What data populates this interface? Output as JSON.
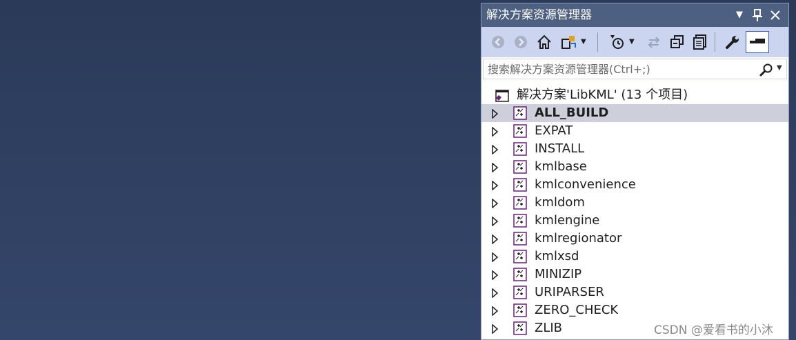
{
  "panel": {
    "title": "解决方案资源管理器",
    "title_buttons": [
      "chevron-down",
      "pin",
      "close"
    ]
  },
  "toolbar": {
    "tools": [
      {
        "name": "back-icon",
        "enabled": false
      },
      {
        "name": "forward-icon",
        "enabled": false
      },
      {
        "name": "home-icon",
        "enabled": true
      },
      {
        "name": "switch-views-icon",
        "enabled": true
      },
      {
        "name": "dropdown-icon",
        "enabled": true
      },
      {
        "name": "pending-changes-filter-icon",
        "enabled": true
      },
      {
        "name": "dropdown-icon",
        "enabled": true
      },
      {
        "name": "sync-icon",
        "enabled": false
      },
      {
        "name": "collapse-all-icon",
        "enabled": true
      },
      {
        "name": "show-all-files-icon",
        "enabled": true
      },
      {
        "name": "wrench-icon",
        "enabled": true
      },
      {
        "name": "preview-icon",
        "enabled": true
      }
    ]
  },
  "search": {
    "placeholder": "搜索解决方案资源管理器(Ctrl+;)"
  },
  "solution": {
    "label": "解决方案'LibKML' (13 个项目)"
  },
  "projects": [
    {
      "label": "ALL_BUILD",
      "bold": true,
      "selected": true
    },
    {
      "label": "EXPAT"
    },
    {
      "label": "INSTALL"
    },
    {
      "label": "kmlbase"
    },
    {
      "label": "kmlconvenience"
    },
    {
      "label": "kmldom"
    },
    {
      "label": "kmlengine"
    },
    {
      "label": "kmlregionator"
    },
    {
      "label": "kmlxsd"
    },
    {
      "label": "MINIZIP"
    },
    {
      "label": "URIPARSER"
    },
    {
      "label": "ZERO_CHECK"
    },
    {
      "label": "ZLIB"
    }
  ],
  "watermark": "CSDN @爱看书的小沐",
  "colors": {
    "background": "#2b3a58",
    "titlebar": "#4d6082",
    "toolbar": "#ccd5f0",
    "selected_row": "#cdd0db",
    "project_icon": "#68217a"
  }
}
